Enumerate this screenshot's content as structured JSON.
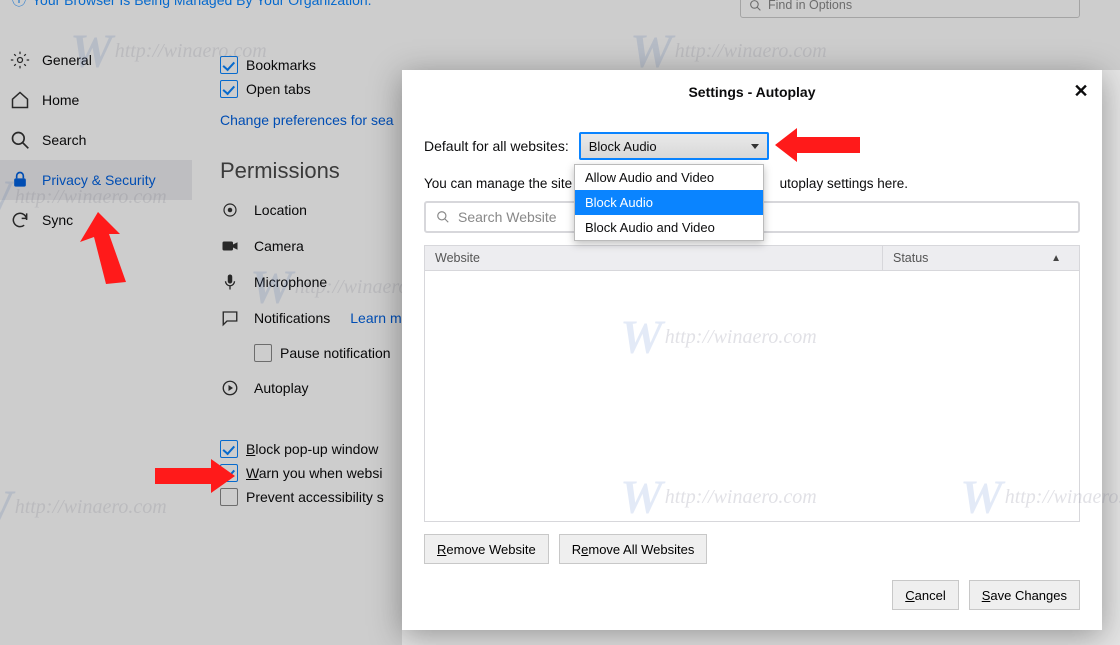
{
  "topbar": {
    "notice": "Your Browser Is Being Managed By Your Organization."
  },
  "find": {
    "placeholder": "Find in Options"
  },
  "sidebar": {
    "items": [
      {
        "label": "General"
      },
      {
        "label": "Home"
      },
      {
        "label": "Search"
      },
      {
        "label": "Privacy & Security"
      },
      {
        "label": "Sync"
      }
    ]
  },
  "main": {
    "bookmarks": "Bookmarks",
    "open_tabs": "Open tabs",
    "change_prefs": "Change preferences for sea",
    "permissions_title": "Permissions",
    "rows": {
      "location": "Location",
      "camera": "Camera",
      "microphone": "Microphone",
      "notifications": "Notifications",
      "learn_more": "Learn m",
      "pause": "Pause notification",
      "autoplay": "Autoplay",
      "block_popup": "Block pop-up window",
      "warn": "Warn you when websi",
      "prevent_acc": "Prevent accessibility s"
    }
  },
  "modal": {
    "title": "Settings - Autoplay",
    "default_label": "Default for all websites:",
    "default_value": "Block Audio",
    "options": [
      "Allow Audio and Video",
      "Block Audio",
      "Block Audio and Video"
    ],
    "hint_a": "You can manage the site",
    "hint_b": "utoplay settings here.",
    "search_placeholder": "Search Website",
    "col_website": "Website",
    "col_status": "Status",
    "remove_website": "Remove Website",
    "remove_all": "Remove All Websites",
    "cancel": "Cancel",
    "save": "Save Changes"
  },
  "watermark": "http://winaero.com"
}
